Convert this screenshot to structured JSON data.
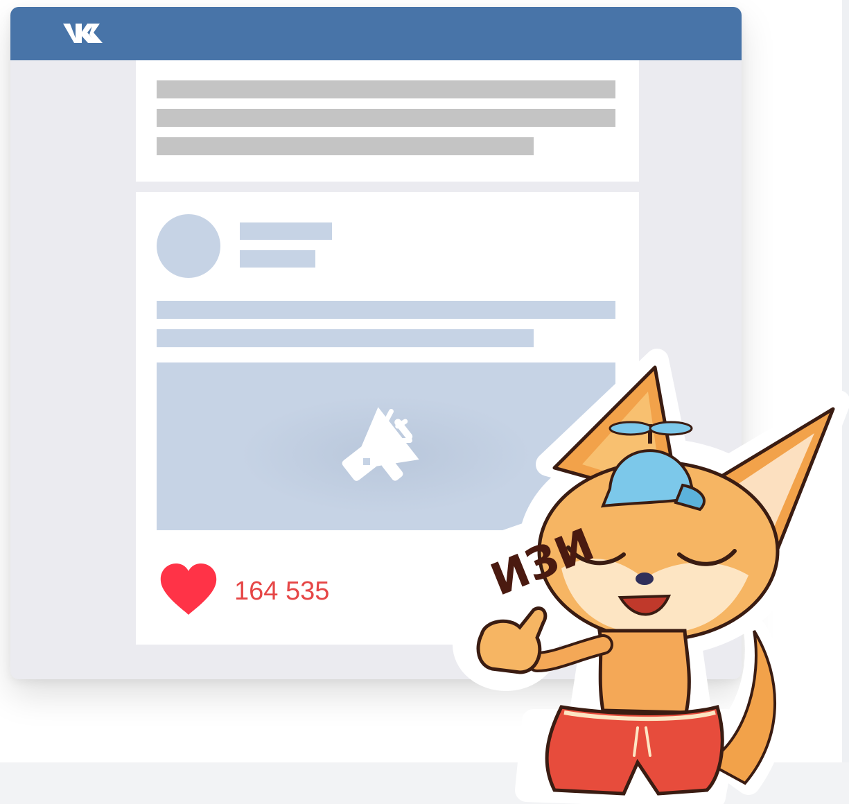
{
  "brand": {
    "logo_text": "VK",
    "header_color": "#4874a8"
  },
  "post": {
    "likes_count": "164 535",
    "like_icon": "heart-icon",
    "like_color": "#e64646",
    "media_icon": "megaphone-icon"
  },
  "sticker": {
    "caption": "ИЗИ"
  }
}
